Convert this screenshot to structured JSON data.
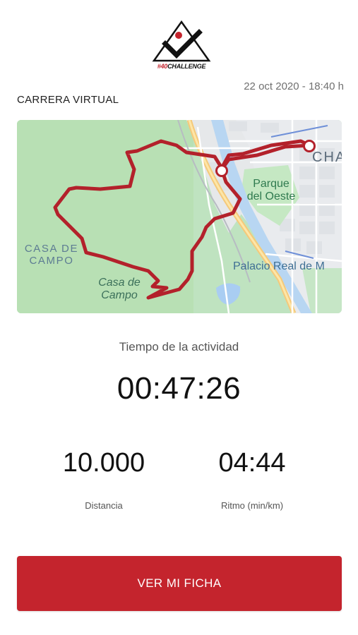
{
  "brand": {
    "hashtag_prefix": "#40",
    "hashtag_name": "CHALLENGE",
    "accent_color": "#c4242d"
  },
  "header": {
    "date_time": "22 oct 2020 - 18:40 h",
    "title": "CARRERA VIRTUAL"
  },
  "map": {
    "labels": {
      "casa_de_campo_area": "CASA DE CAMPO",
      "casa_de_campo_park": "Casa de Campo",
      "parque_del_oeste": "Parque del Oeste",
      "palacio_real": "Palacio Real de M",
      "chamberi_partial": "CHA"
    },
    "route_color": "#b3212b"
  },
  "activity": {
    "label": "Tiempo de la actividad",
    "time": "00:47:26"
  },
  "stats": {
    "distance": {
      "value": "10.000",
      "label": "Distancia"
    },
    "pace": {
      "value": "04:44",
      "label": "Ritmo (min/km)"
    }
  },
  "actions": {
    "view_profile": "VER MI FICHA"
  }
}
